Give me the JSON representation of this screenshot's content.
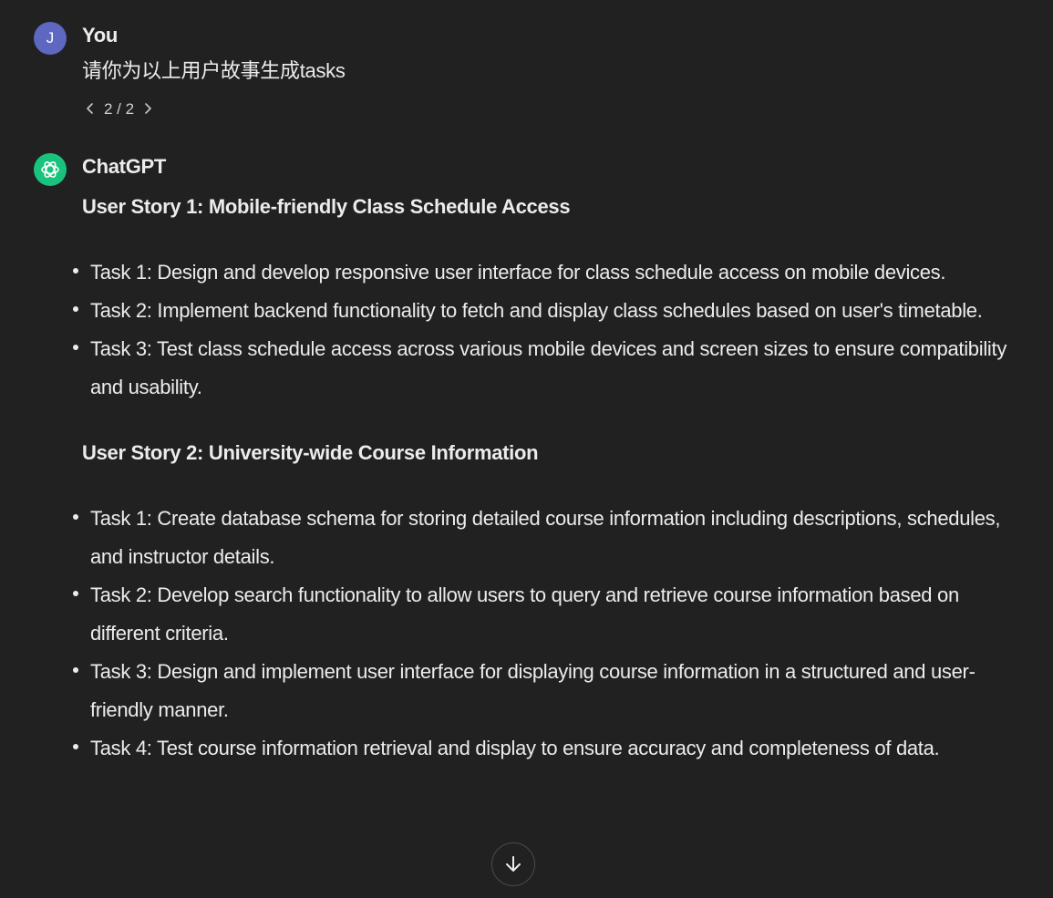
{
  "user_turn": {
    "avatar_letter": "J",
    "author": "You",
    "message": "请你为以上用户故事生成tasks",
    "pager": {
      "current": "2",
      "separator": "/",
      "total": "2",
      "text": "2 / 2"
    }
  },
  "assistant_turn": {
    "author": "ChatGPT",
    "stories": [
      {
        "title": "User Story 1: Mobile-friendly Class Schedule Access",
        "tasks": [
          "Task 1: Design and develop responsive user interface for class schedule access on mobile devices.",
          "Task 2: Implement backend functionality to fetch and display class schedules based on user's timetable.",
          "Task 3: Test class schedule access across various mobile devices and screen sizes to ensure compatibility and usability."
        ]
      },
      {
        "title": "User Story 2: University-wide Course Information",
        "tasks": [
          "Task 1: Create database schema for storing detailed course information including descriptions, schedules, and instructor details.",
          "Task 2: Develop search functionality to allow users to query and retrieve course information based on different criteria.",
          "Task 3: Design and implement user interface for displaying course information in a structured and user-friendly manner.",
          "Task 4: Test course information retrieval and display to ensure accuracy and completeness of data."
        ]
      }
    ]
  },
  "icons": {
    "prev": "chevron-left-icon",
    "next": "chevron-right-icon",
    "assistant_logo": "openai-logo-icon",
    "scroll": "arrow-down-icon"
  },
  "colors": {
    "background": "#212121",
    "text": "#ececec",
    "user_avatar": "#5e68c1",
    "assistant_avatar": "#19c37d"
  }
}
